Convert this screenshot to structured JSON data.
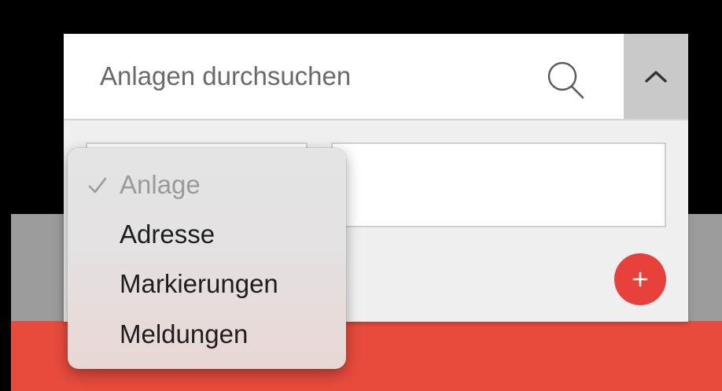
{
  "search": {
    "placeholder": "Anlagen durchsuchen"
  },
  "icons": {
    "search": "search-icon",
    "collapse": "chevron-up-icon",
    "add": "plus-icon",
    "check": "check-icon"
  },
  "add_button": {
    "label": "+"
  },
  "dropdown": {
    "items": [
      {
        "label": "Anlage",
        "selected": true
      },
      {
        "label": "Adresse",
        "selected": false
      },
      {
        "label": "Markierungen",
        "selected": false
      },
      {
        "label": "Meldungen",
        "selected": false
      }
    ]
  },
  "colors": {
    "accent_red": "#e84b3c",
    "add_button": "#e8413c",
    "collapse_button": "#c9c9c9"
  }
}
